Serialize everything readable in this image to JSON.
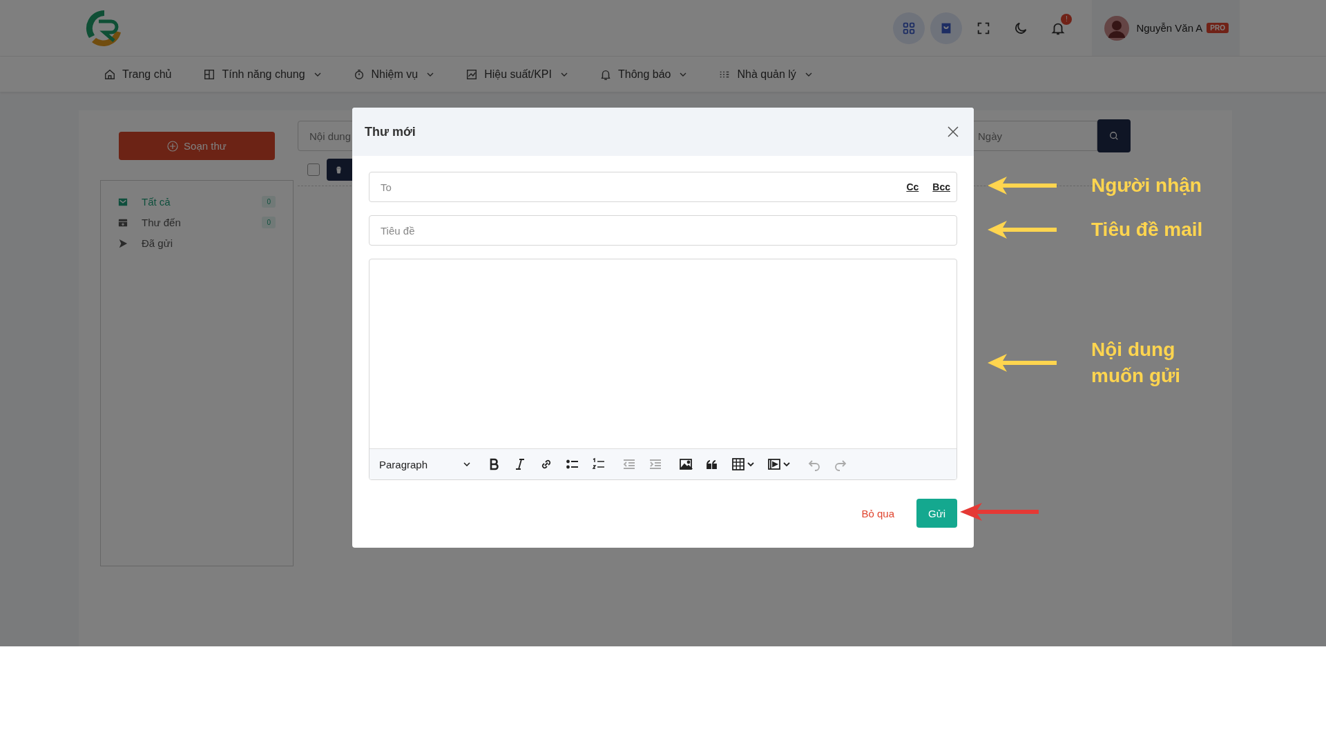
{
  "header": {
    "icons": [
      {
        "kind": "apps",
        "highlighted": true
      },
      {
        "kind": "bag",
        "highlighted": true
      },
      {
        "kind": "fullscreen",
        "highlighted": false
      },
      {
        "kind": "moon",
        "highlighted": false
      },
      {
        "kind": "bell",
        "highlighted": false,
        "badge": "!"
      }
    ],
    "user": {
      "name": "Nguyễn Văn A",
      "badge": "PRO"
    }
  },
  "nav": [
    {
      "kind": "home",
      "label": "Trang chủ",
      "dropdown": false
    },
    {
      "kind": "layout",
      "label": "Tính năng chung",
      "dropdown": true
    },
    {
      "kind": "timer",
      "label": "Nhiệm vụ",
      "dropdown": true
    },
    {
      "kind": "chart",
      "label": "Hiệu suất/KPI",
      "dropdown": true
    },
    {
      "kind": "bell",
      "label": "Thông báo",
      "dropdown": true
    },
    {
      "kind": "grid",
      "label": "Nhà quản lý",
      "dropdown": true
    }
  ],
  "compose_button": "Soạn thư",
  "folders": [
    {
      "kind": "all",
      "label": "Tất cả",
      "count": "0",
      "selected": true
    },
    {
      "kind": "inbox",
      "label": "Thư đến",
      "count": "0",
      "selected": false
    },
    {
      "kind": "sent",
      "label": "Đã gửi",
      "selected": false
    }
  ],
  "filters": {
    "content_placeholder": "Nội dung",
    "date_placeholder": "Ngày",
    "select_all_checked": false
  },
  "modal": {
    "title": "Thư mới",
    "to_placeholder": "To",
    "cc": "Cc",
    "bcc": "Bcc",
    "subject_placeholder": "Tiêu đề",
    "format": "Paragraph",
    "toolbar": [
      {
        "kind": "bold",
        "disabled": false
      },
      {
        "kind": "italic",
        "disabled": false
      },
      {
        "kind": "link",
        "disabled": false
      },
      {
        "kind": "bullets",
        "disabled": false
      },
      {
        "kind": "numbers",
        "disabled": false
      },
      {
        "kind": "outdent",
        "disabled": true
      },
      {
        "kind": "indent",
        "disabled": true
      },
      {
        "kind": "image",
        "disabled": false
      },
      {
        "kind": "quote",
        "disabled": false
      },
      {
        "kind": "table",
        "disabled": false
      },
      {
        "kind": "media",
        "disabled": false
      },
      {
        "kind": "undo",
        "disabled": true
      },
      {
        "kind": "redo",
        "disabled": true
      }
    ],
    "cancel": "Bỏ qua",
    "send": "Gửi"
  },
  "annotations": [
    {
      "text": "Người nhận",
      "color": "#ffd54f"
    },
    {
      "text": "Tiêu đề mail",
      "color": "#ffd54f"
    },
    {
      "text": "Nội dung muốn gửi",
      "color": "#ffd54f"
    },
    {
      "color": "#e53935"
    }
  ]
}
